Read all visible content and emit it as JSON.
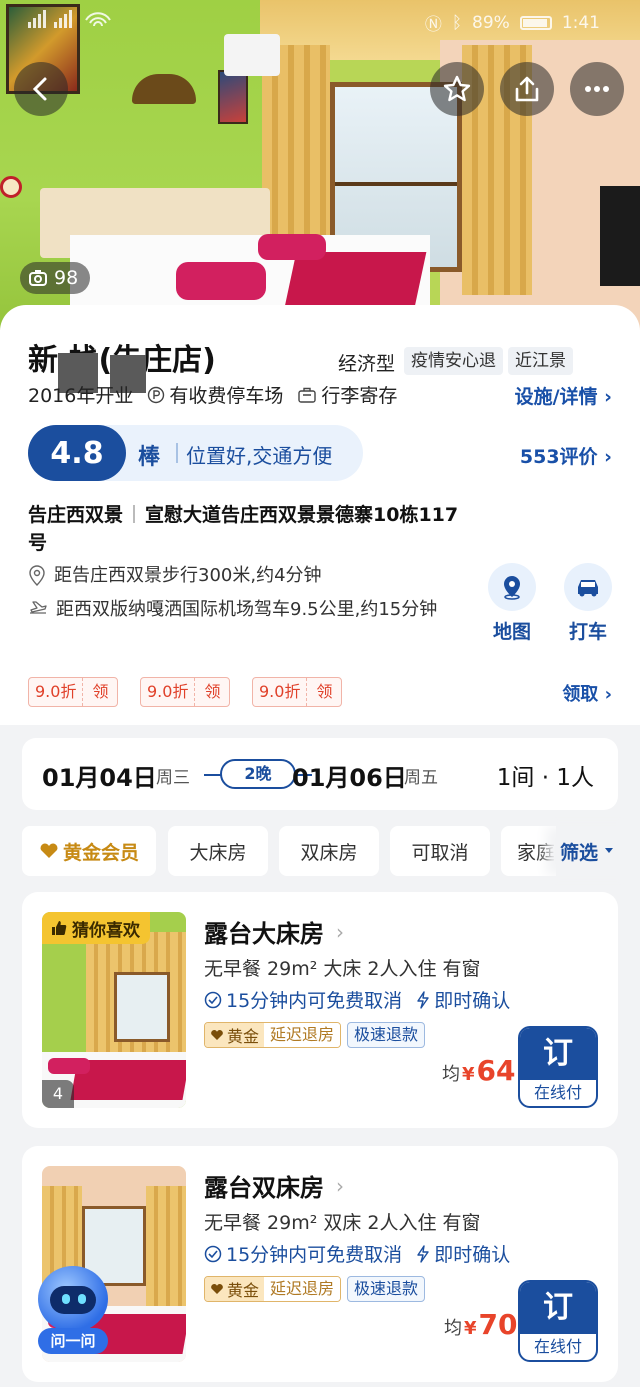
{
  "status_bar": {
    "left": "",
    "battery": "89%",
    "time": "1:41"
  },
  "gallery": {
    "photo_count": "98"
  },
  "hotel": {
    "name": "新 栈(告庄店)",
    "type": "经济型",
    "tags": [
      "疫情安心退",
      "近江景"
    ],
    "facilities": [
      "2016年开业",
      "有收费停车场",
      "行李寄存"
    ],
    "detail_link": "设施/详情",
    "rating": {
      "score": "4.8",
      "word": "棒",
      "desc": "位置好,交通方便"
    },
    "reviews": "553评价",
    "address": {
      "area": "告庄西双景",
      "street": "宣慰大道告庄西双景景德寨10栋117号"
    },
    "distance_walk": "距告庄西双景步行300米,约4分钟",
    "distance_airport": "距西双版纳嘎洒国际机场驾车9.5公里,约15分钟",
    "actions": {
      "map": "地图",
      "taxi": "打车"
    },
    "coupons": [
      {
        "discount": "9.0折",
        "action": "领"
      },
      {
        "discount": "9.0折",
        "action": "领"
      },
      {
        "discount": "9.0折",
        "action": "领"
      }
    ],
    "coupon_link": "领取"
  },
  "booking": {
    "checkin_date": "01月04日",
    "checkin_weekday": "周三",
    "nights": "2晚",
    "checkout_date": "01月06日",
    "checkout_weekday": "周五",
    "rooms_guests": "1间 · 1人"
  },
  "filters": {
    "chips": [
      "黄金会员",
      "大床房",
      "双床房",
      "可取消",
      "家庭"
    ],
    "filter_label": "筛选"
  },
  "rooms": [
    {
      "badge": "猜你喜欢",
      "img_count": "4",
      "title": "露台大床房",
      "specs": "无早餐  29m²  大床  2人入住  有窗",
      "cancel": "15分钟内可免费取消",
      "confirm": "即时确认",
      "gold_label": "黄金",
      "gold_benefit": "延迟退房",
      "refund": "极速退款",
      "price_prefix": "均",
      "currency": "¥",
      "price": "64",
      "book": "订",
      "pay": "在线付"
    },
    {
      "badge": "",
      "img_count": "",
      "title": "露台双床房",
      "specs": "无早餐  29m²  双床  2人入住  有窗",
      "cancel": "15分钟内可免费取消",
      "confirm": "即时确认",
      "gold_label": "黄金",
      "gold_benefit": "延迟退房",
      "refund": "极速退款",
      "price_prefix": "均",
      "currency": "¥",
      "price": "70",
      "book": "订",
      "pay": "在线付"
    }
  ],
  "assistant": {
    "label": "问一问"
  },
  "colors": {
    "brand_blue": "#1b4e9e",
    "price_red": "#e8442a",
    "gold": "#c78a14"
  }
}
